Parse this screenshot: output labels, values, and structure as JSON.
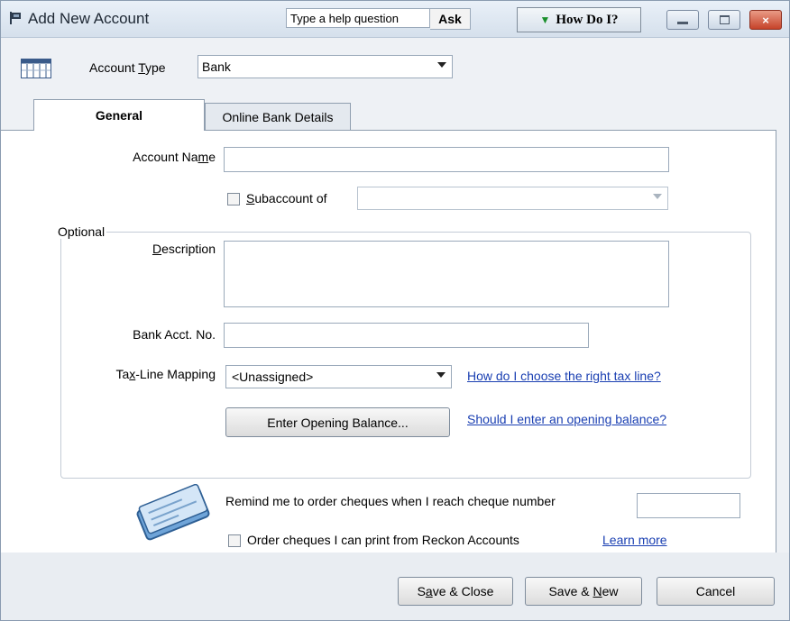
{
  "window": {
    "title": "Add New Account",
    "help_placeholder": "Type a help question",
    "ask_label": "Ask",
    "how_do_i_label": "How Do I?",
    "close_glyph": "×"
  },
  "account_type": {
    "label_pre": "Account ",
    "label_u": "T",
    "label_post": "ype",
    "value": "Bank"
  },
  "tabs": [
    {
      "label": "General",
      "active": true
    },
    {
      "label": "Online Bank Details",
      "active": false
    }
  ],
  "form": {
    "account_name_pre": "Account Na",
    "account_name_u": "m",
    "account_name_post": "e",
    "account_name_value": "",
    "subaccount_u": "S",
    "subaccount_post": "ubaccount of",
    "optional_legend": "Optional",
    "description_u": "D",
    "description_post": "escription",
    "description_value": "",
    "bank_acct_label": "Bank Acct. No.",
    "bank_acct_value": "",
    "taxline_pre": "Ta",
    "taxline_u": "x",
    "taxline_post": "-Line Mapping",
    "taxline_value": "<Unassigned>",
    "taxline_link": "How do I choose the right tax line?",
    "opening_balance_pre": "Enter Openin",
    "opening_balance_u": "g",
    "opening_balance_post": " Balance...",
    "opening_balance_link": "Should I enter an opening balance?",
    "remind_label": "Remind me to order cheques when I reach cheque number",
    "remind_value": "",
    "order_label": "Order cheques I can print from Reckon Accounts",
    "learn_more": "Learn more"
  },
  "footer": {
    "save_close_pre": "S",
    "save_close_u": "a",
    "save_close_post": "ve & Close",
    "save_new_pre": "Save & ",
    "save_new_u": "N",
    "save_new_post": "ew",
    "cancel": "Cancel"
  },
  "colors": {
    "link": "#1a3fb2",
    "title_bg": "#d5e0ec",
    "how_do_i_arrow": "#1b8f2c",
    "close_button": "#c6432a"
  }
}
